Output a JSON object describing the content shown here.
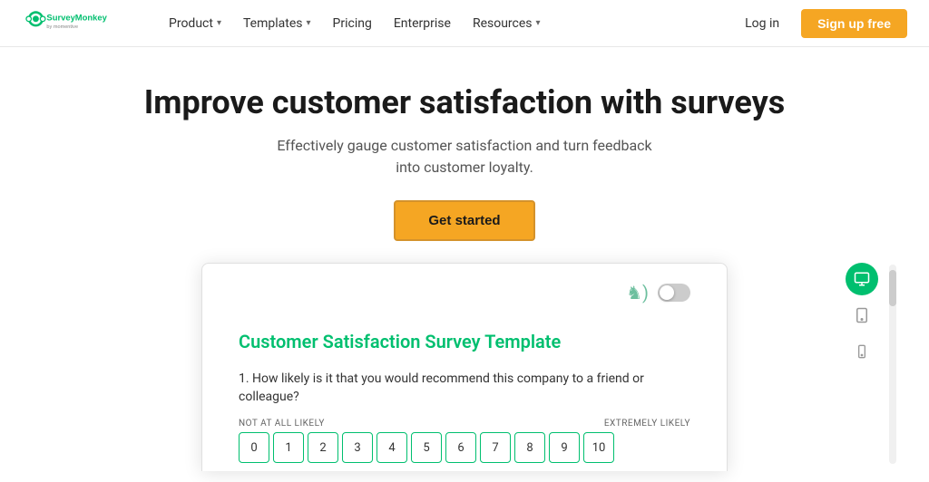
{
  "header": {
    "logo_alt": "SurveyMonkey by Momentive",
    "nav": [
      {
        "label": "Product",
        "has_dropdown": true
      },
      {
        "label": "Templates",
        "has_dropdown": true
      },
      {
        "label": "Pricing",
        "has_dropdown": false
      },
      {
        "label": "Enterprise",
        "has_dropdown": false
      },
      {
        "label": "Resources",
        "has_dropdown": true
      }
    ],
    "login_label": "Log in",
    "signup_label": "Sign up free"
  },
  "hero": {
    "heading": "Improve customer satisfaction with surveys",
    "subtext": "Effectively gauge customer satisfaction and turn feedback into customer loyalty.",
    "cta_label": "Get started"
  },
  "survey_preview": {
    "title": "Customer Satisfaction Survey Template",
    "question": "1. How likely is it that you would recommend this company to a friend or colleague?",
    "scale_low_label": "NOT AT ALL LIKELY",
    "scale_high_label": "EXTREMELY LIKELY",
    "scale_values": [
      "0",
      "1",
      "2",
      "3",
      "4",
      "5",
      "6",
      "7",
      "8",
      "9",
      "10"
    ]
  },
  "colors": {
    "green": "#00bf6f",
    "orange": "#f5a623",
    "nav_text": "#333333"
  }
}
